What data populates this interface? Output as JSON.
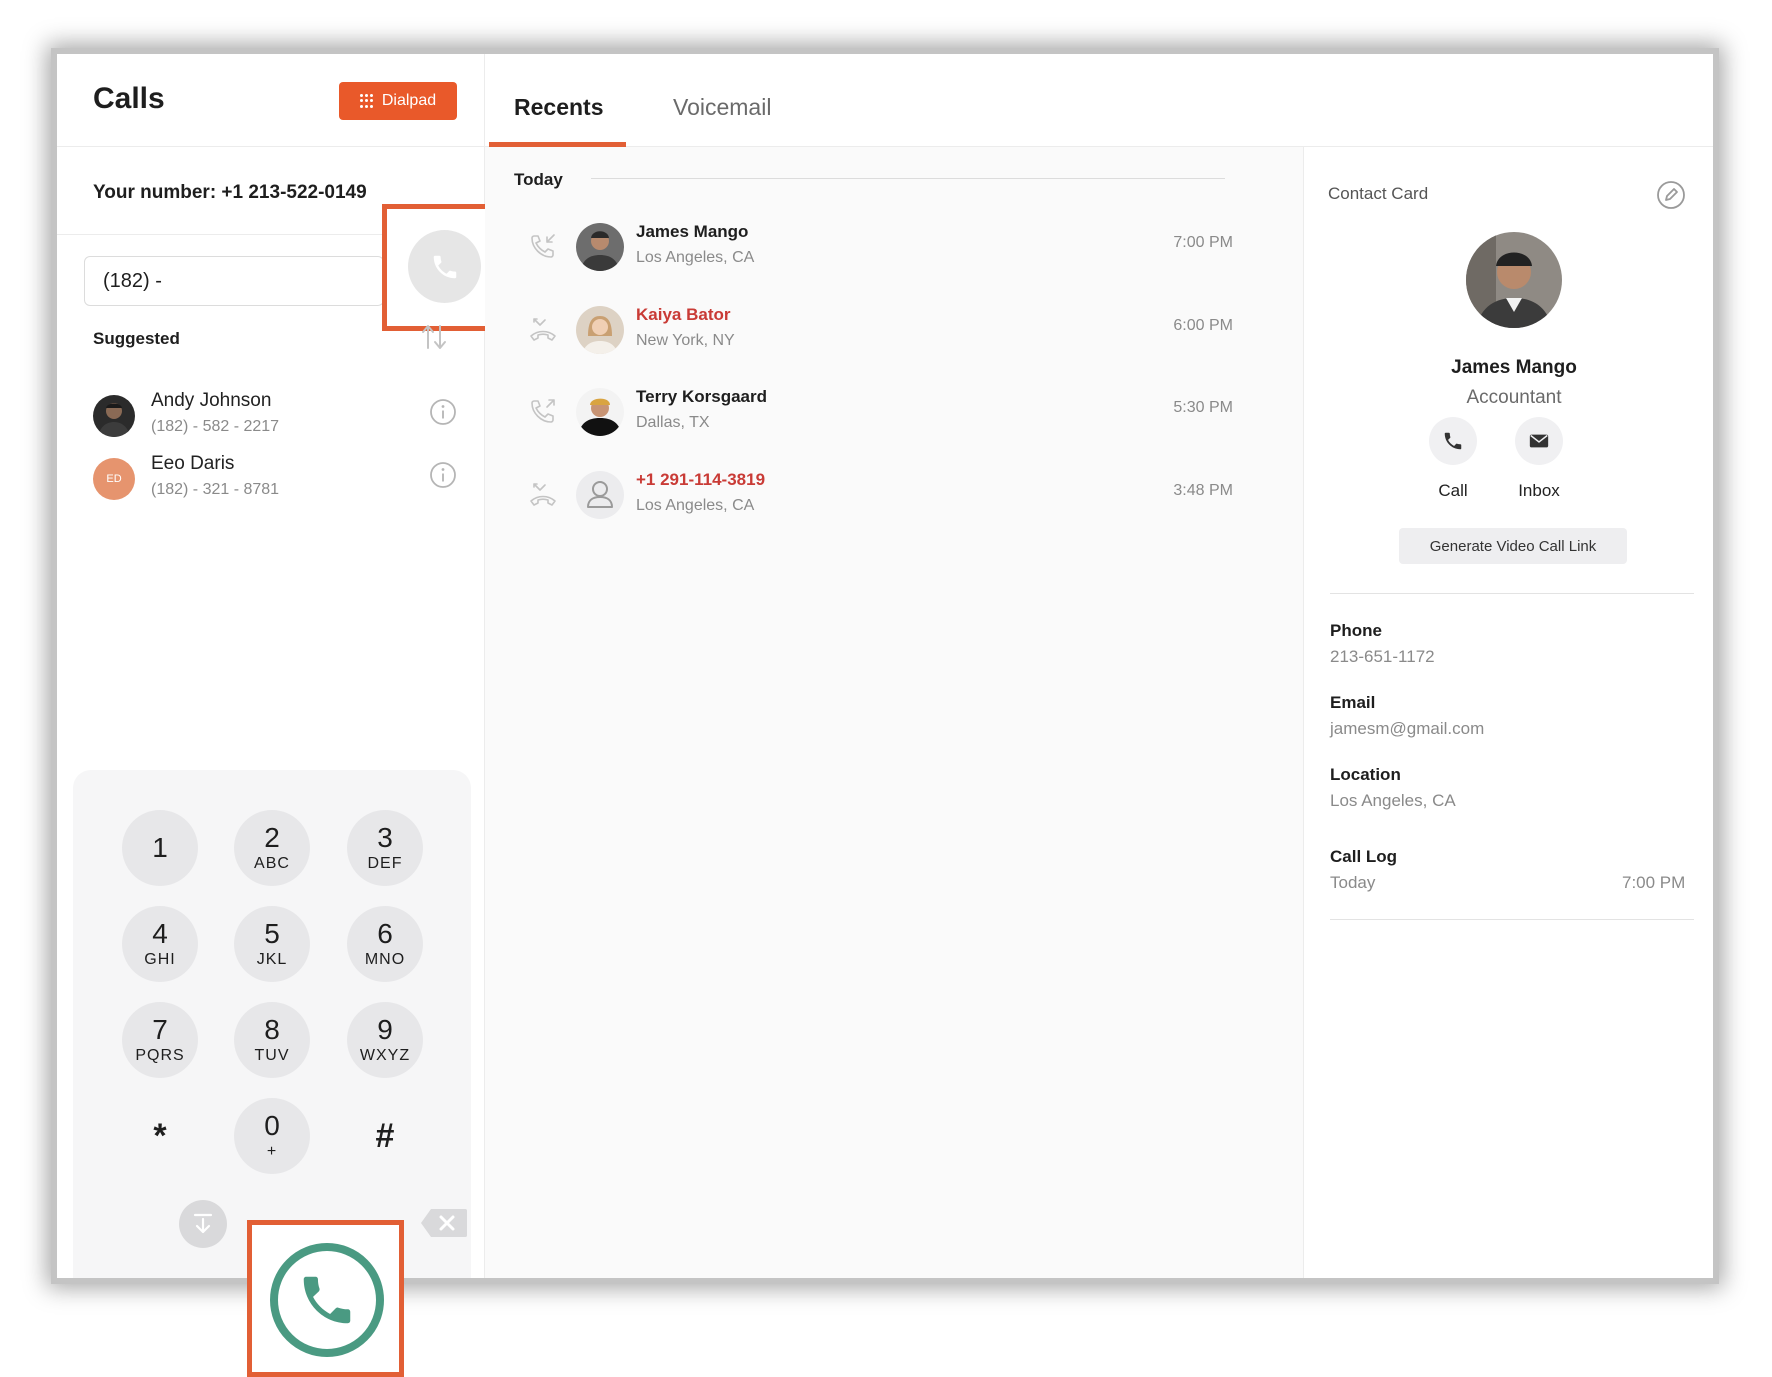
{
  "sidebar": {
    "title": "Calls",
    "dialpad_label": "Dialpad",
    "your_number": "Your number: +1 213-522-0149",
    "input_value": "(182) -",
    "suggested_label": "Suggested",
    "suggested": [
      {
        "name": "Andy Johnson",
        "phone": "(182) - 582 - 2217"
      },
      {
        "name": "Eeo Daris",
        "phone": "(182) - 321 - 8781",
        "initials": "ED"
      }
    ]
  },
  "keypad": {
    "keys": [
      {
        "digit": "1",
        "letters": ""
      },
      {
        "digit": "2",
        "letters": "ABC"
      },
      {
        "digit": "3",
        "letters": "DEF"
      },
      {
        "digit": "4",
        "letters": "GHI"
      },
      {
        "digit": "5",
        "letters": "JKL"
      },
      {
        "digit": "6",
        "letters": "MNO"
      },
      {
        "digit": "7",
        "letters": "PQRS"
      },
      {
        "digit": "8",
        "letters": "TUV"
      },
      {
        "digit": "9",
        "letters": "WXYZ"
      },
      {
        "digit": "*",
        "letters": ""
      },
      {
        "digit": "0",
        "letters": "+"
      },
      {
        "digit": "#",
        "letters": ""
      }
    ]
  },
  "tabs": {
    "recents": "Recents",
    "voicemail": "Voicemail"
  },
  "recents": {
    "group_label": "Today",
    "items": [
      {
        "name": "James Mango",
        "location": "Los Angeles, CA",
        "time": "7:00 PM",
        "type": "incoming",
        "missed": false
      },
      {
        "name": "Kaiya Bator",
        "location": "New York, NY",
        "time": "6:00 PM",
        "type": "missed",
        "missed": true
      },
      {
        "name": "Terry Korsgaard",
        "location": "Dallas, TX",
        "time": "5:30 PM",
        "type": "outgoing",
        "missed": false
      },
      {
        "name": "+1 291-114-3819",
        "location": "Los Angeles, CA",
        "time": "3:48 PM",
        "type": "missed",
        "missed": true
      }
    ]
  },
  "contact_card": {
    "title": "Contact Card",
    "name": "James Mango",
    "role": "Accountant",
    "call_label": "Call",
    "inbox_label": "Inbox",
    "video_link_label": "Generate Video Call Link",
    "phone_label": "Phone",
    "phone_value": "213-651-1172",
    "email_label": "Email",
    "email_value": "jamesm@gmail.com",
    "location_label": "Location",
    "location_value": "Los Angeles, CA",
    "call_log_label": "Call Log",
    "call_log_day": "Today",
    "call_log_time": "7:00 PM"
  },
  "colors": {
    "accent": "#e9592a",
    "highlight_border": "#e25f35",
    "call_green": "#4a9a82",
    "missed_red": "#c93b36"
  }
}
